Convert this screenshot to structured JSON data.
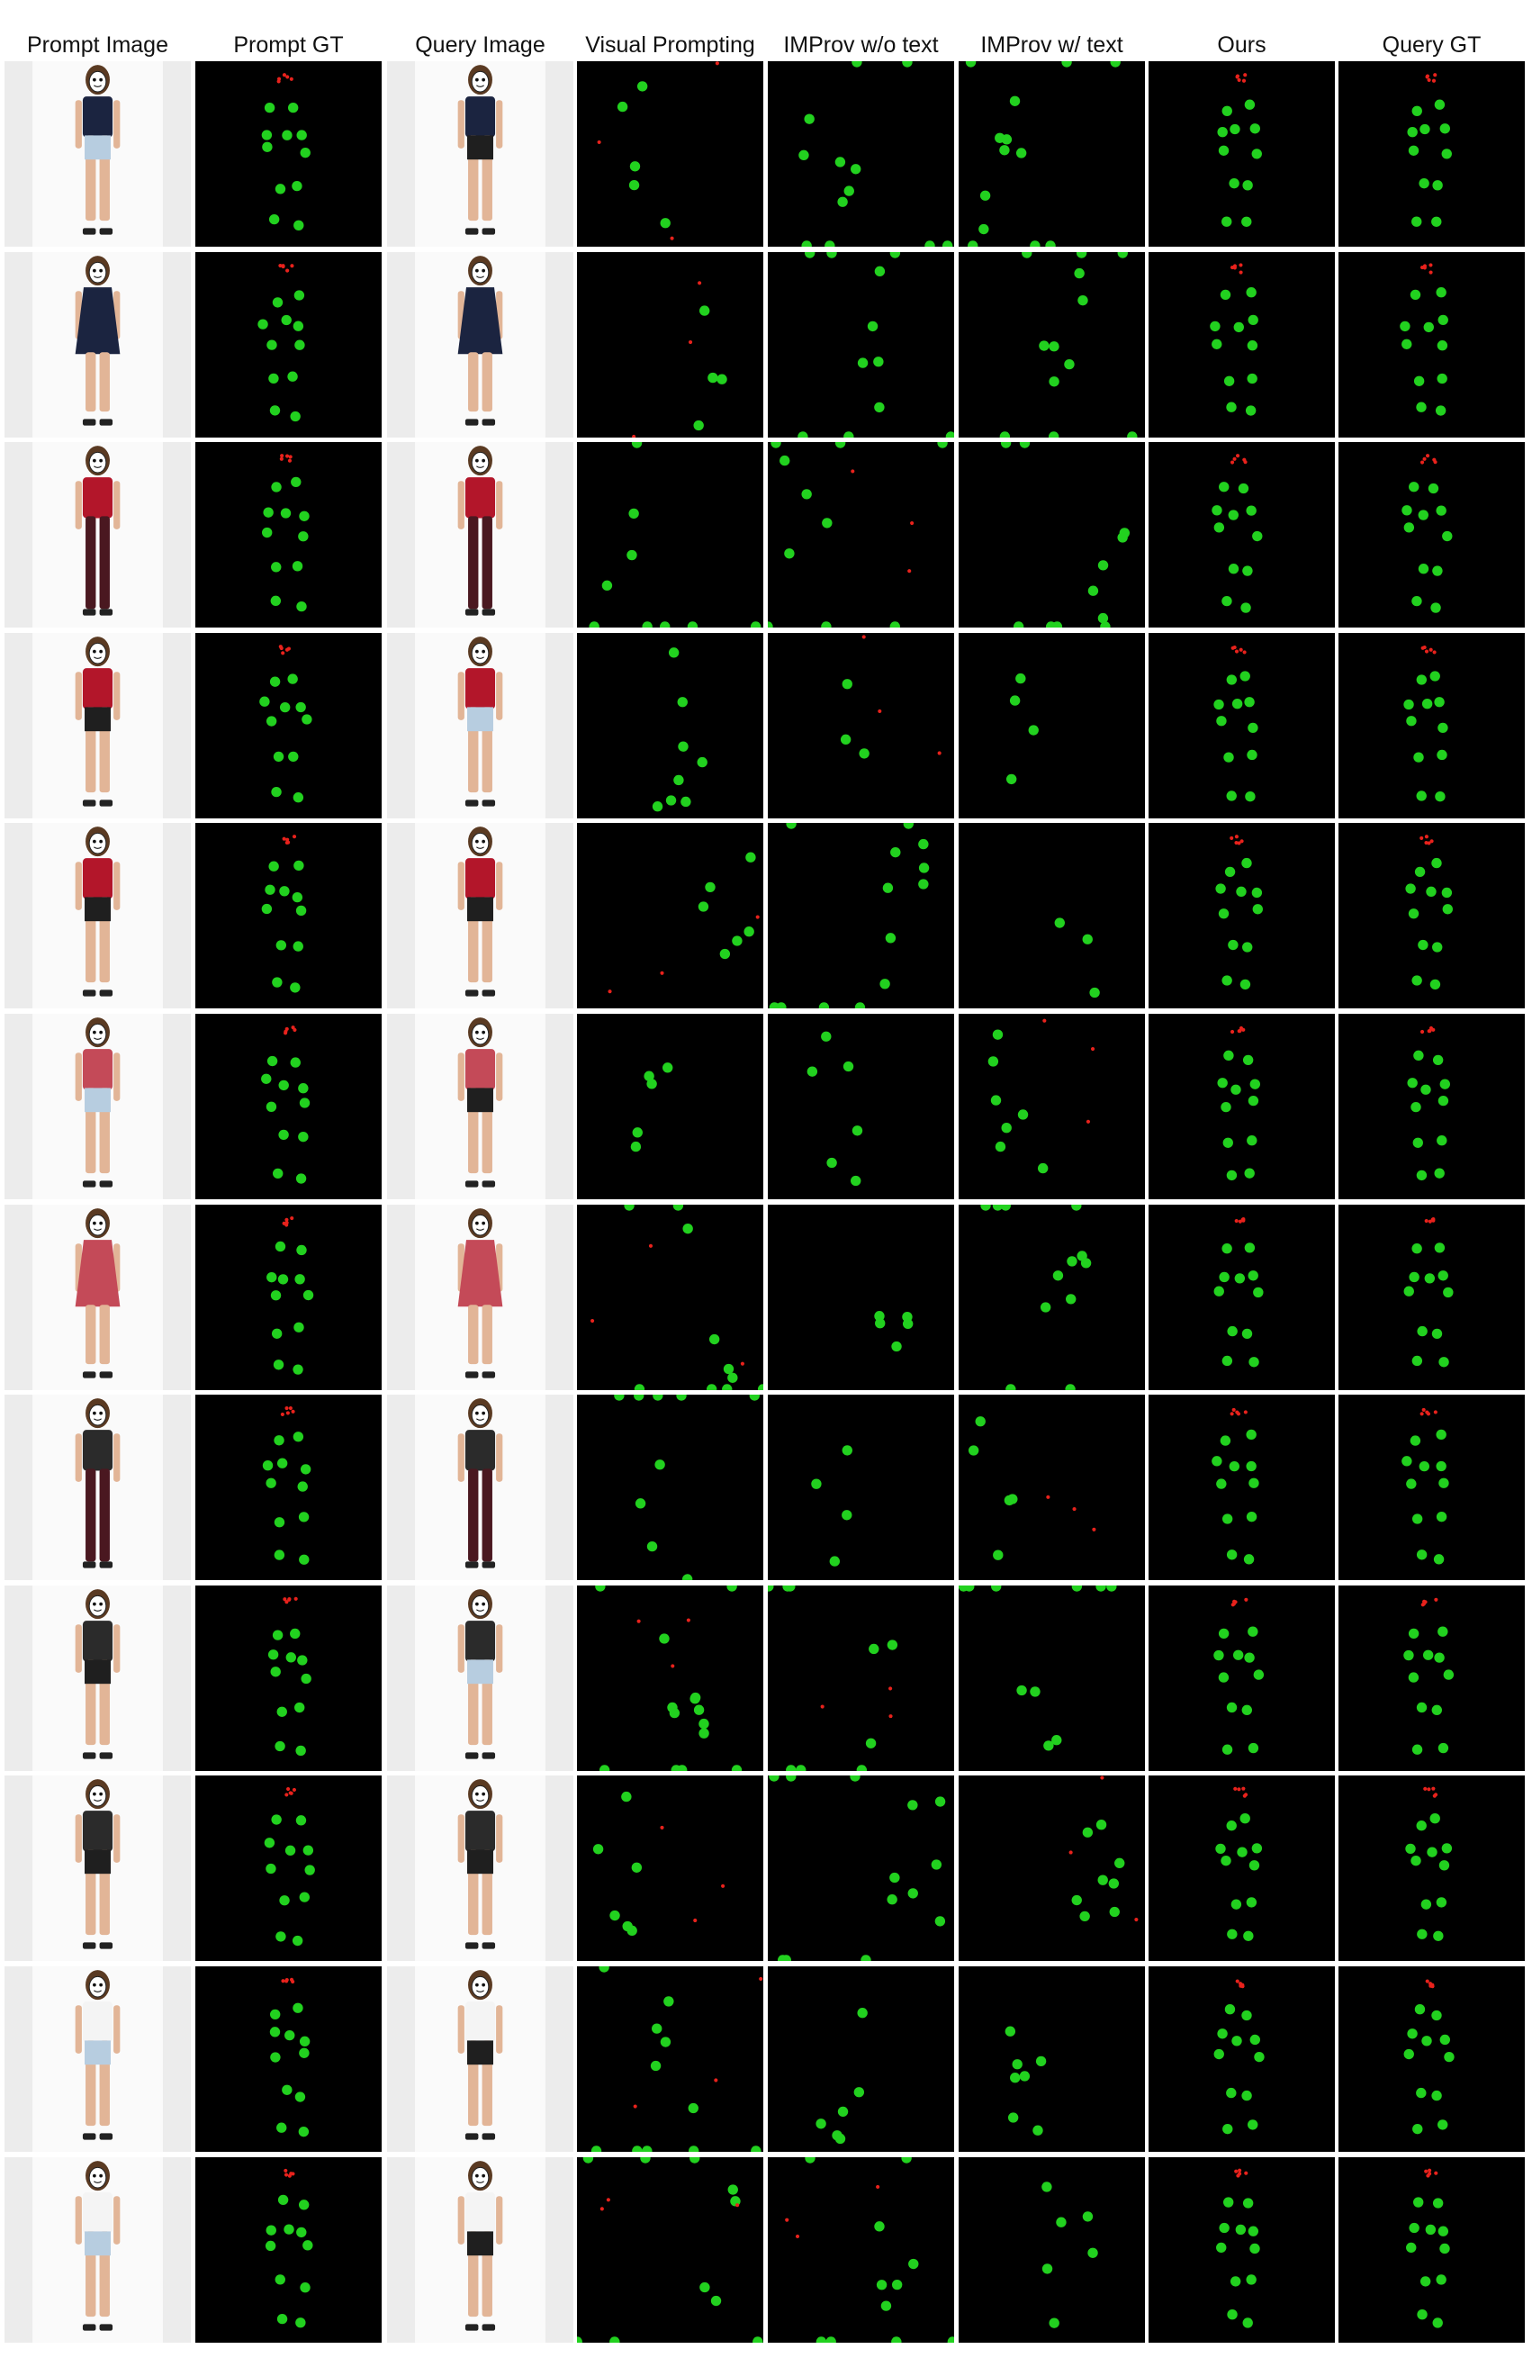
{
  "headers": [
    "Prompt Image",
    "Prompt GT",
    "Query Image",
    "Visual Prompting",
    "IMProv w/o text",
    "IMProv w/ text",
    "Ours",
    "Query GT"
  ],
  "rows": [
    {
      "prompt_outfit": "top",
      "query_outfit": "top"
    },
    {
      "prompt_outfit": "dress",
      "query_outfit": "dress"
    },
    {
      "prompt_outfit": "man",
      "query_outfit": "man"
    },
    {
      "prompt_outfit": "top",
      "query_outfit": "top"
    },
    {
      "prompt_outfit": "top",
      "query_outfit": "top"
    },
    {
      "prompt_outfit": "top",
      "query_outfit": "top"
    },
    {
      "prompt_outfit": "dress",
      "query_outfit": "dress"
    },
    {
      "prompt_outfit": "man",
      "query_outfit": "man"
    },
    {
      "prompt_outfit": "top",
      "query_outfit": "top"
    },
    {
      "prompt_outfit": "top",
      "query_outfit": "top"
    },
    {
      "prompt_outfit": "top",
      "query_outfit": "top"
    },
    {
      "prompt_outfit": "top",
      "query_outfit": "top"
    }
  ],
  "colors": {
    "keypoint_body": "#22d11f",
    "keypoint_head": "#e8221c",
    "heatmap_bg": "#000000",
    "photo_bg": "#f3f3f3"
  }
}
